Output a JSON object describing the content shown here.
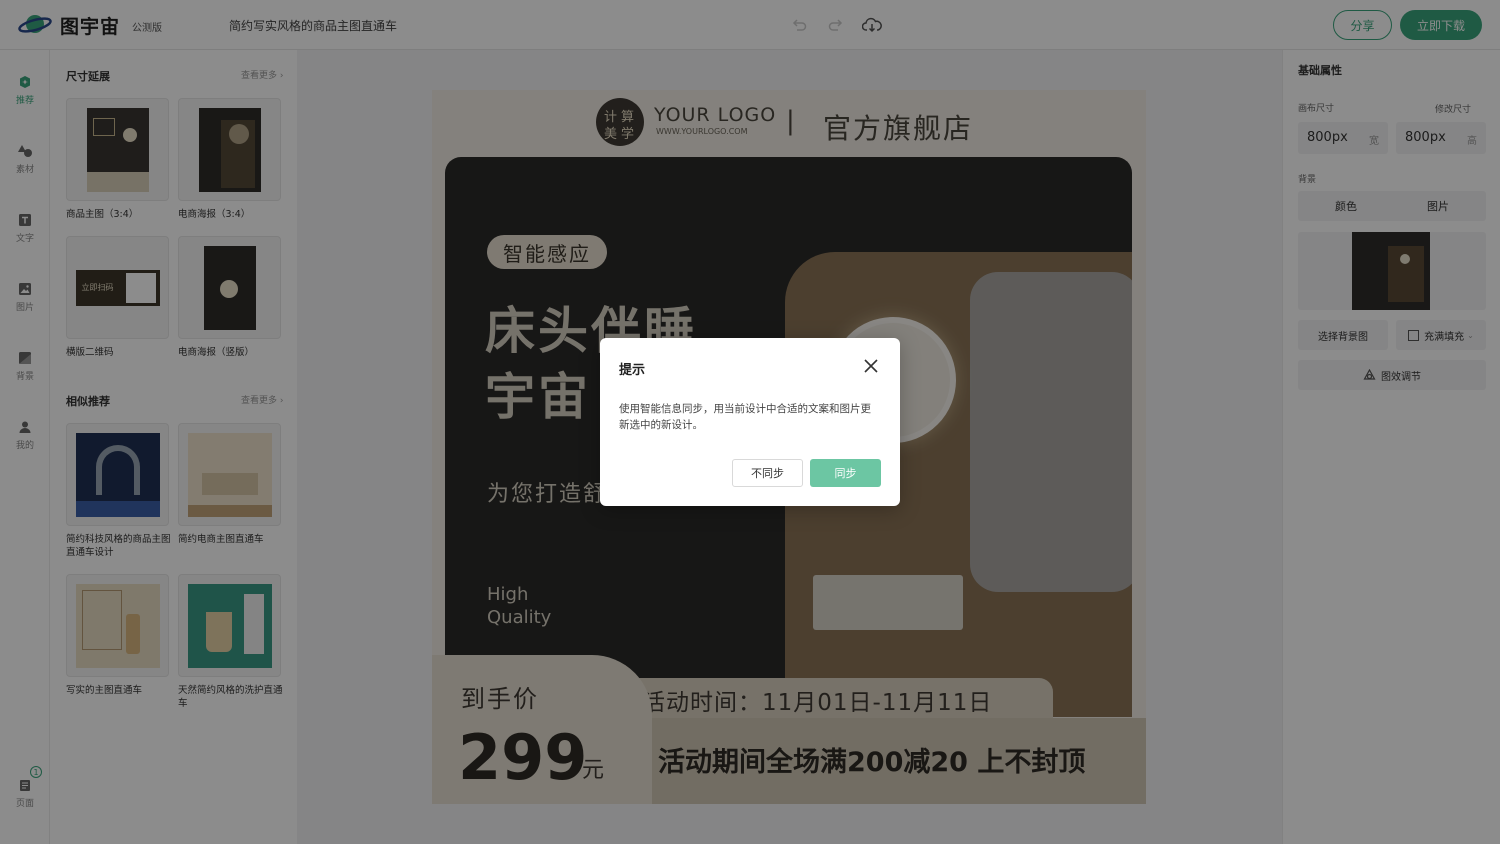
{
  "header": {
    "logo_text": "图宇宙",
    "beta_tag": "公测版",
    "doc_title": "简约写实风格的商品主图直通车",
    "share_label": "分享",
    "download_label": "立即下载",
    "accent_color": "#3aa57d"
  },
  "rail": {
    "items": [
      {
        "label": "推荐",
        "icon": "recommend-icon"
      },
      {
        "label": "素材",
        "icon": "shapes-icon"
      },
      {
        "label": "文字",
        "icon": "text-icon"
      },
      {
        "label": "图片",
        "icon": "image-icon"
      },
      {
        "label": "背景",
        "icon": "background-icon"
      },
      {
        "label": "我的",
        "icon": "user-icon"
      },
      {
        "label": "页面",
        "icon": "pages-icon"
      }
    ],
    "page_count": "1"
  },
  "left_panel": {
    "section1_title": "尺寸延展",
    "section1_more": "查看更多",
    "section1_items": [
      "商品主图（3:4）",
      "电商海报（3:4）",
      "横版二维码",
      "电商海报（竖版）"
    ],
    "section2_title": "相似推荐",
    "section2_more": "查看更多",
    "section2_items": [
      "简约科技风格的商品主图直通车设计",
      "简约电商主图直通车",
      "写实的主图直通车",
      "天然简约风格的洗护直通车"
    ],
    "qr_thumb_text": "立即扫码"
  },
  "right_panel": {
    "title": "基础属性",
    "canvas_size_label": "画布尺寸",
    "resize_label": "修改尺寸",
    "width_value": "800px",
    "width_unit": "宽",
    "height_value": "800px",
    "height_unit": "高",
    "background_label": "背景",
    "tab_color": "颜色",
    "tab_image": "图片",
    "choose_bg": "选择背景图",
    "fill_mode": "充满填充",
    "image_adjust": "图效调节"
  },
  "canvas": {
    "logo_chars": [
      "计",
      "算",
      "美",
      "学"
    ],
    "logo_text": "YOUR LOGO",
    "logo_url": "WWW.YOURLOGO.COM",
    "divider": "|",
    "store_name": "官方旗舰店",
    "tag": "智能感应",
    "headline1": "床头伴睡",
    "headline2": "宇宙",
    "subline": "为您打造舒",
    "quality1": "High",
    "quality2": "Quality",
    "price_label": "到手价",
    "price_value": "299",
    "price_unit": "元",
    "activity_time": "活动时间：11月01日-11月11日",
    "promo_text": "活动期间全场满200减20  上不封顶"
  },
  "modal": {
    "title": "提示",
    "message": "使用智能信息同步，用当前设计中合适的文案和图片更新选中的新设计。",
    "cancel_label": "不同步",
    "confirm_label": "同步"
  }
}
